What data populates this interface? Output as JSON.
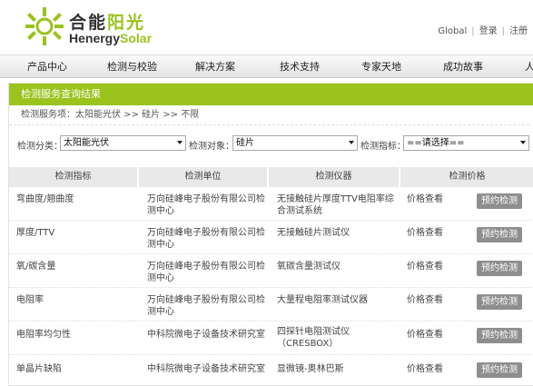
{
  "brand": {
    "name_cn_black": "合能",
    "name_cn_green": "阳光",
    "name_en_black": "Henergy",
    "name_en_green": "Solar",
    "accent_color": "#9ac31c"
  },
  "top_links": {
    "global": "Global",
    "sep": "|",
    "login": "登录",
    "register": "注册"
  },
  "nav": {
    "items": [
      "产品中心",
      "检测与校验",
      "解决方案",
      "技术支持",
      "专家天地",
      "成功故事",
      "人"
    ]
  },
  "panel": {
    "title": "检测服务查询结果",
    "breadcrumb": "检测服务项：太阳能光伏 >> 硅片 >> 不限"
  },
  "filters": {
    "category_label": "检测分类：",
    "category_value": "太阳能光伏",
    "object_label": "检测对象：",
    "object_value": "硅片",
    "indicator_label": "检测指标：",
    "indicator_value": "==请选择=="
  },
  "table": {
    "headers": [
      "检测指标",
      "检测单位",
      "检测仪器",
      "检测价格"
    ],
    "rows": [
      {
        "indicator": "弯曲度/翘曲度",
        "unit_l1": "万向硅峰电子股份有限公司检",
        "unit_l2": "测中心",
        "instr_l1": "无接触硅片厚度TTV电阻率综",
        "instr_l2": "合测试系统",
        "price": "价格查看",
        "action": "预约检测"
      },
      {
        "indicator": "厚度/TTV",
        "unit_l1": "万向硅峰电子股份有限公司检",
        "unit_l2": "测中心",
        "instr_l1": "无接触硅片测试仪",
        "instr_l2": "",
        "price": "价格查看",
        "action": "预约检测"
      },
      {
        "indicator": "氧/碳含量",
        "unit_l1": "万向硅峰电子股份有限公司检",
        "unit_l2": "测中心",
        "instr_l1": "氧碳含量测试仪",
        "instr_l2": "",
        "price": "价格查看",
        "action": "预约检测"
      },
      {
        "indicator": "电阻率",
        "unit_l1": "万向硅峰电子股份有限公司检",
        "unit_l2": "测中心",
        "instr_l1": "大量程电阻率测试仪器",
        "instr_l2": "",
        "price": "价格查看",
        "action": "预约检测"
      },
      {
        "indicator": "电阻率均匀性",
        "unit_l1": "中科院微电子设备技术研究室",
        "unit_l2": "",
        "instr_l1": "四探针电阻测试仪",
        "instr_l2": "（CRESBOX）",
        "price": "价格查看",
        "action": "预约检测"
      },
      {
        "indicator": "单晶片缺陷",
        "unit_l1": "中科院微电子设备技术研究室",
        "unit_l2": "",
        "instr_l1": "显微镜-奥林巴斯",
        "instr_l2": "",
        "price": "价格查看",
        "action": "预约检测"
      }
    ]
  }
}
